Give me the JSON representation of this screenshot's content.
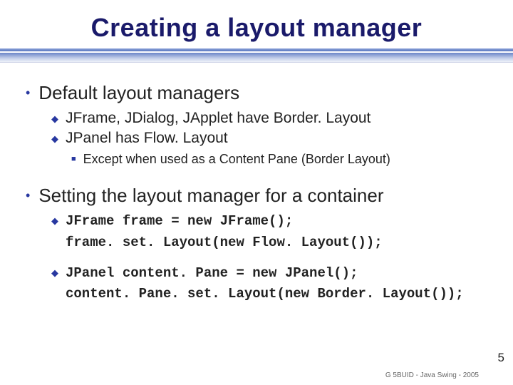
{
  "title": "Creating a layout manager",
  "bullets": {
    "b1": {
      "heading": "Default layout managers",
      "sub1": "JFrame, JDialog, JApplet have Border. Layout",
      "sub2": "JPanel has Flow. Layout",
      "subsub": "Except when used as a Content Pane (Border Layout)"
    },
    "b2": {
      "heading": "Setting the layout manager for a container",
      "code1a": "JFrame frame = new JFrame();",
      "code1b": "frame. set. Layout(new Flow. Layout());",
      "code2a": "JPanel content. Pane = new JPanel();",
      "code2b": "content. Pane. set. Layout(new Border. Layout());"
    }
  },
  "footer": "G 5BUID - Java Swing - 2005",
  "page": "5"
}
